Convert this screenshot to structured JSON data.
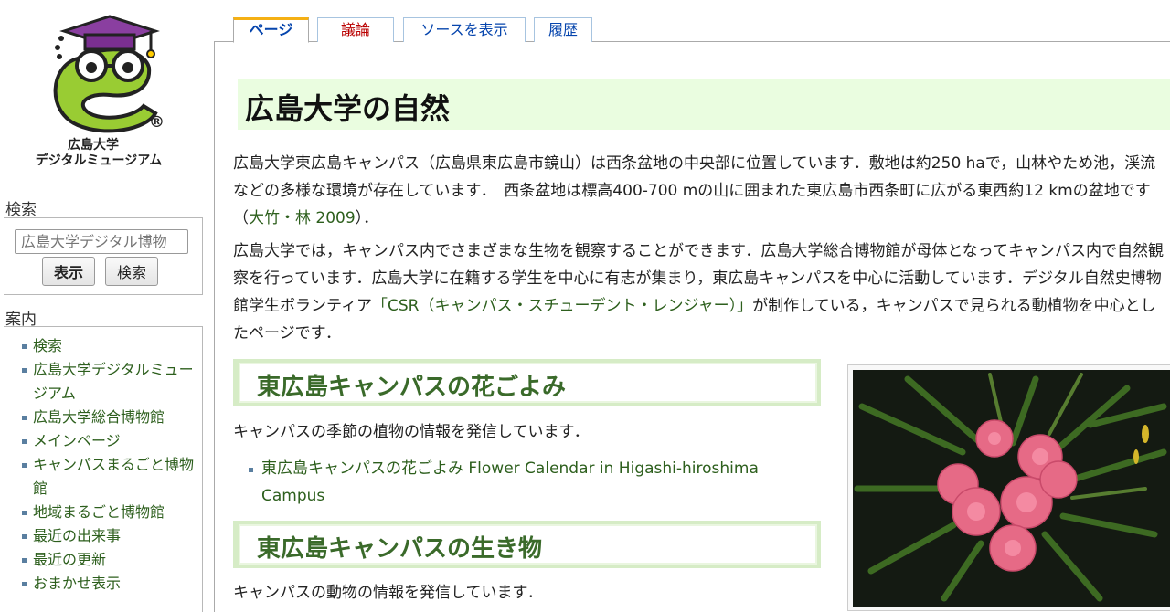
{
  "logo": {
    "line1": "広島大学",
    "line2": "デジタルミュージアム",
    "registered_mark": "®"
  },
  "sidebar": {
    "search_heading": "検索",
    "search_placeholder": "広島大学デジタル博物",
    "go_label": "表示",
    "search_label": "検索",
    "nav_heading": "案内",
    "nav_items": [
      "検索",
      "広島大学デジタルミュージアム",
      "広島大学総合博物館",
      "メインページ",
      "キャンパスまるごと博物館",
      "地域まるごと博物館",
      "最近の出来事",
      "最近の更新",
      "おまかせ表示"
    ]
  },
  "tabs": {
    "page": "ページ",
    "talk": "議論",
    "source": "ソースを表示",
    "history": "履歴"
  },
  "main": {
    "title": "広島大学の自然",
    "intro1_a": "広島大学東広島キャンパス（広島県東広島市鏡山）は西条盆地の中央部に位置しています．敷地は約250 haで，山林やため池，渓流などの多様な環境が存在しています．　西条盆地は標高400-700 mの山に囲まれた東広島市西条町に広がる東西約12 kmの盆地です（",
    "intro1_link": "大竹・林 2009",
    "intro1_b": "）．",
    "intro2_a": "広島大学では，キャンパス内でさまざまな生物を観察することができます．広島大学総合博物館が母体となってキャンパス内で自然観察を行っています．広島大学に在籍する学生を中心に有志が集まり，東広島キャンパスを中心に活動しています．デジタル自然史博物館学生ボランティア",
    "intro2_link": "「CSR（キャンパス・スチューデント・レンジャー）」",
    "intro2_b": "が制作している，キャンパスで見られる動植物を中心としたページです．",
    "section_flowers": "東広島キャンパスの花ごよみ",
    "flowers_desc": "キャンパスの季節の植物の情報を発信しています．",
    "flowers_link": "東広島キャンパスの花ごよみ Flower Calendar in Higashi-hiroshima Campus",
    "section_life": "東広島キャンパスの生き物",
    "life_desc": "キャンパスの動物の情報を発信しています．"
  },
  "colors": {
    "accent_green": "#3a6a2a",
    "link_green": "#2d5f1d",
    "title_bg": "#eafde0",
    "tab_active": "#f5b014"
  }
}
